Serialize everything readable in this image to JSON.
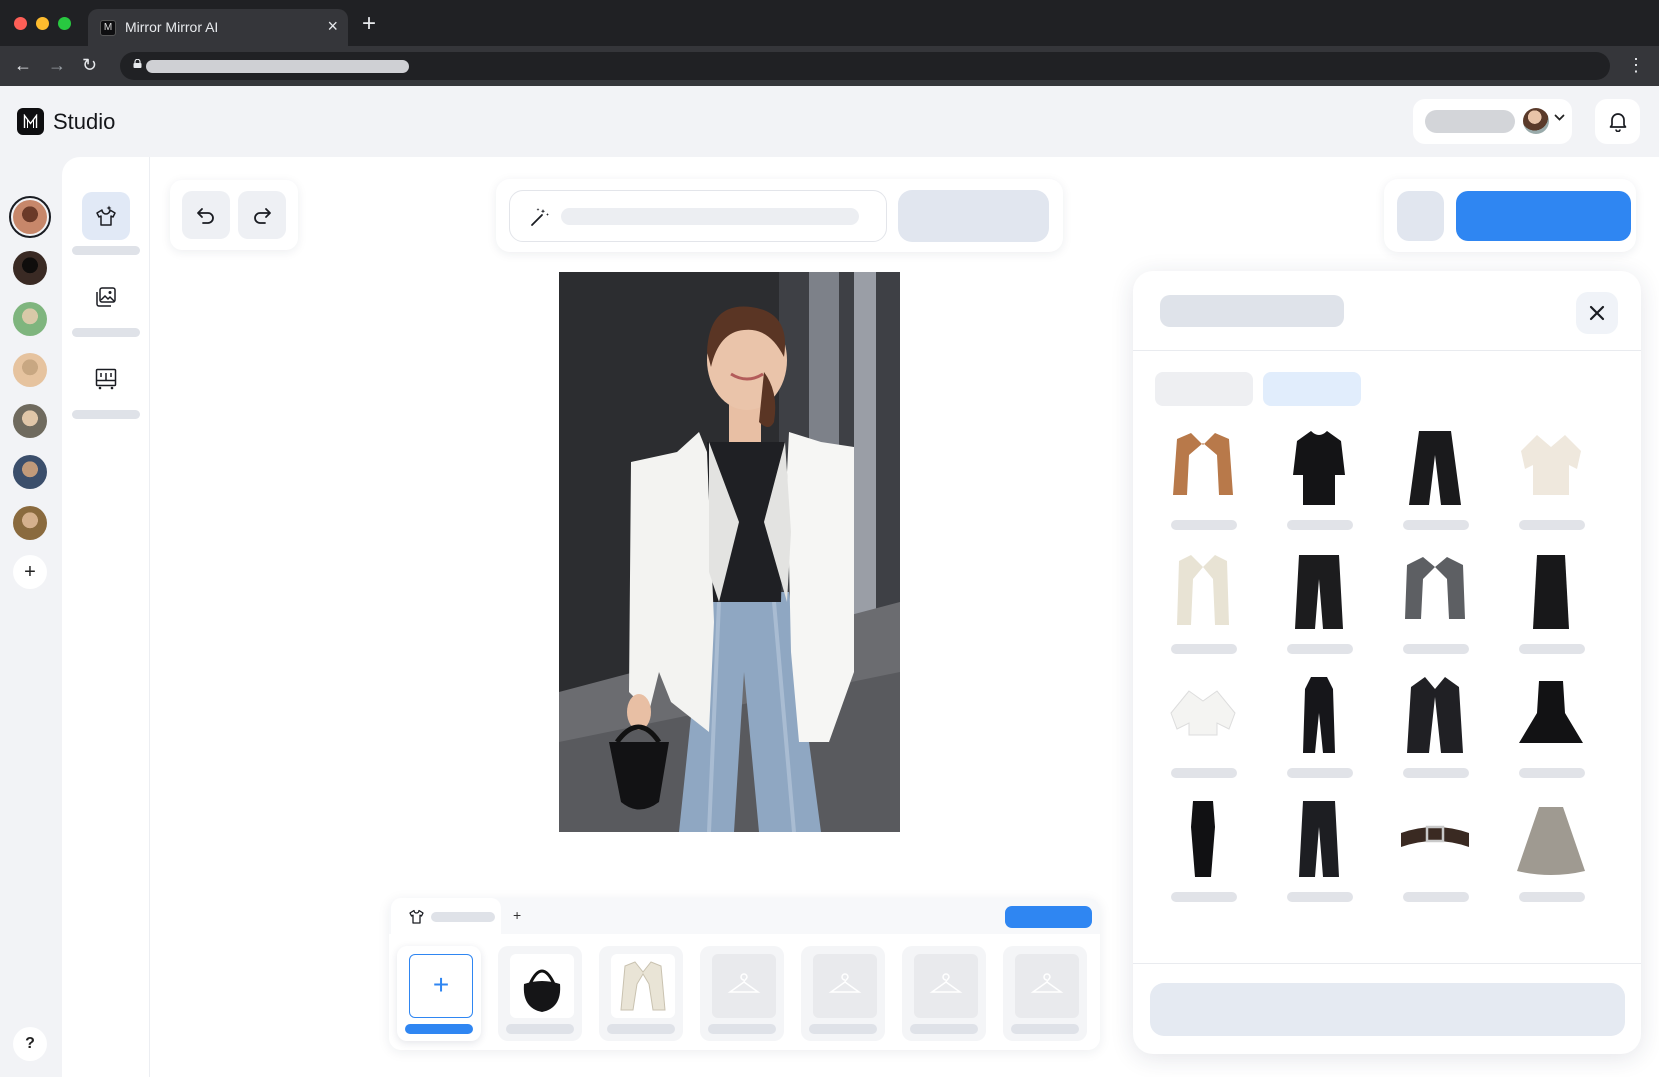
{
  "browser": {
    "tab_title": "Mirror Mirror AI",
    "tab_close_icon": "close-icon",
    "new_tab_icon": "plus-icon"
  },
  "app": {
    "name": "Studio",
    "logo_glyph": "M"
  },
  "avatars": [
    {
      "name": "model-avatar-1",
      "selected": true
    },
    {
      "name": "model-avatar-2",
      "selected": false
    },
    {
      "name": "model-avatar-3",
      "selected": false
    },
    {
      "name": "model-avatar-4",
      "selected": false
    },
    {
      "name": "model-avatar-5",
      "selected": false
    },
    {
      "name": "model-avatar-6",
      "selected": false
    },
    {
      "name": "model-avatar-7",
      "selected": false
    }
  ],
  "rail": {
    "add_avatar": "+",
    "help": "?"
  },
  "tools": [
    {
      "icon": "clothing-sparkle-icon",
      "active": true
    },
    {
      "icon": "gallery-icon",
      "active": false
    },
    {
      "icon": "wardrobe-icon",
      "active": false
    }
  ],
  "outfit_bar": {
    "add_tab": "+",
    "add_item": "+"
  },
  "catalog_items": [
    "camel-wool-coat",
    "black-knit-dress",
    "black-wide-trousers",
    "cream-silk-blouse",
    "cream-blazer",
    "black-leather-culottes",
    "grey-plaid-blazer",
    "black-leather-skirt",
    "white-cropped-shirt",
    "black-jumpsuit",
    "black-vinyl-trench",
    "black-peplum-top",
    "black-cutout-dress",
    "black-straight-jeans",
    "brown-leather-belt",
    "silver-metallic-skirt"
  ],
  "colors": {
    "accent": "#2f86f2",
    "chrome_dark": "#202124",
    "page_bg": "#f2f3f6",
    "active_tool_bg": "#e1e9f6"
  }
}
